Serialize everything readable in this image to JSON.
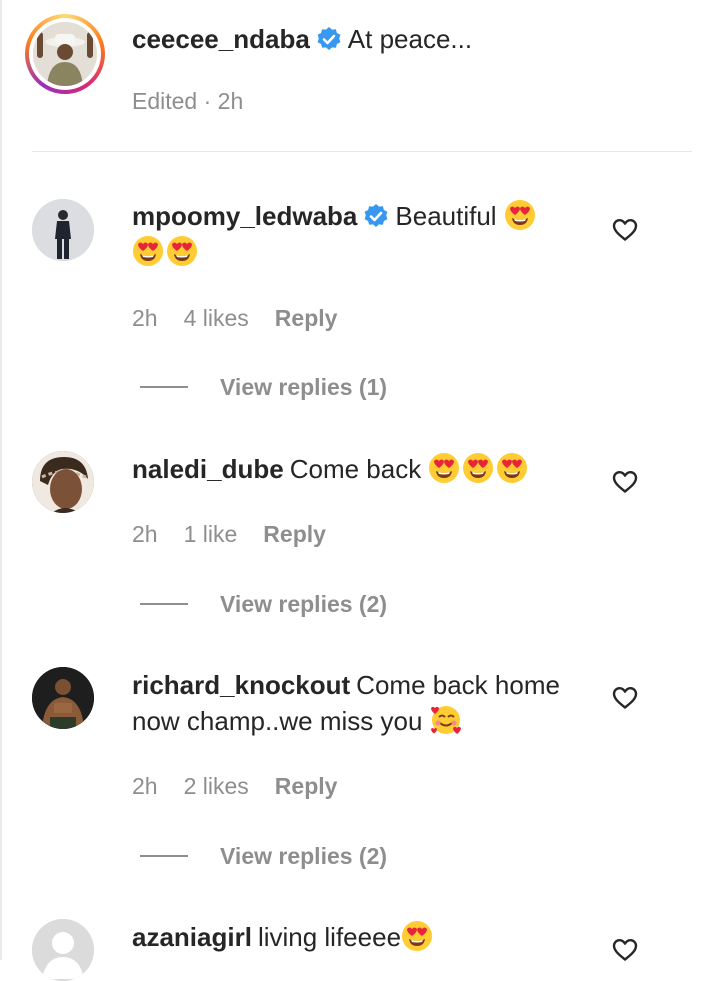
{
  "post": {
    "username": "ceecee_ndaba",
    "caption": "At peace...",
    "meta": "Edited · 2h"
  },
  "comments": [
    {
      "username": "mpoomy_ledwaba",
      "text": "Beautiful",
      "time": "2h",
      "likes": "4 likes",
      "reply": "Reply",
      "view_replies": "View replies (1)"
    },
    {
      "username": "naledi_dube",
      "text": "Come back",
      "time": "2h",
      "likes": "1 like",
      "reply": "Reply",
      "view_replies": "View replies (2)"
    },
    {
      "username": "richard_knockout",
      "text": "Come back home",
      "text2": "now champ..we miss you",
      "time": "2h",
      "likes": "2 likes",
      "reply": "Reply",
      "view_replies": "View replies (2)"
    },
    {
      "username": "azaniagirl",
      "text": "living lifeeee"
    }
  ],
  "icons": {
    "verified": "verified-badge-icon",
    "heart": "heart-outline-icon",
    "heart_eyes": "smiling-face-with-heart-eyes-emoji",
    "hearts_face": "smiling-face-with-hearts-emoji"
  },
  "colors": {
    "verified_blue": "#3897f0",
    "meta_gray": "#8e8e8e",
    "text": "#262626"
  }
}
